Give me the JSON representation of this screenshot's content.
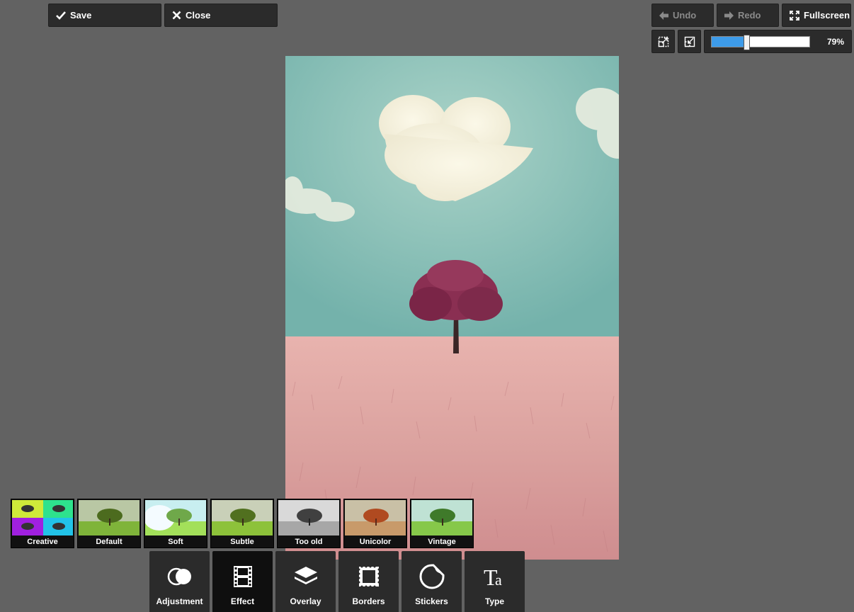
{
  "toolbar": {
    "save_label": "Save",
    "close_label": "Close",
    "undo_label": "Undo",
    "redo_label": "Redo",
    "fullscreen_label": "Fullscreen"
  },
  "zoom": {
    "value": 79,
    "value_label": "79%"
  },
  "effects": [
    {
      "label": "Creative"
    },
    {
      "label": "Default"
    },
    {
      "label": "Soft"
    },
    {
      "label": "Subtle"
    },
    {
      "label": "Too old"
    },
    {
      "label": "Unicolor"
    },
    {
      "label": "Vintage"
    }
  ],
  "tools": [
    {
      "label": "Adjustment",
      "icon": "circles-icon",
      "active": false
    },
    {
      "label": "Effect",
      "icon": "film-icon",
      "active": true
    },
    {
      "label": "Overlay",
      "icon": "layers-icon",
      "active": false
    },
    {
      "label": "Borders",
      "icon": "frame-icon",
      "active": false
    },
    {
      "label": "Stickers",
      "icon": "sticker-icon",
      "active": false
    },
    {
      "label": "Type",
      "icon": "type-icon",
      "active": false
    }
  ],
  "colors": {
    "accent": "#3d9be9",
    "button_bg": "#2b2b2b",
    "background": "#626262"
  }
}
